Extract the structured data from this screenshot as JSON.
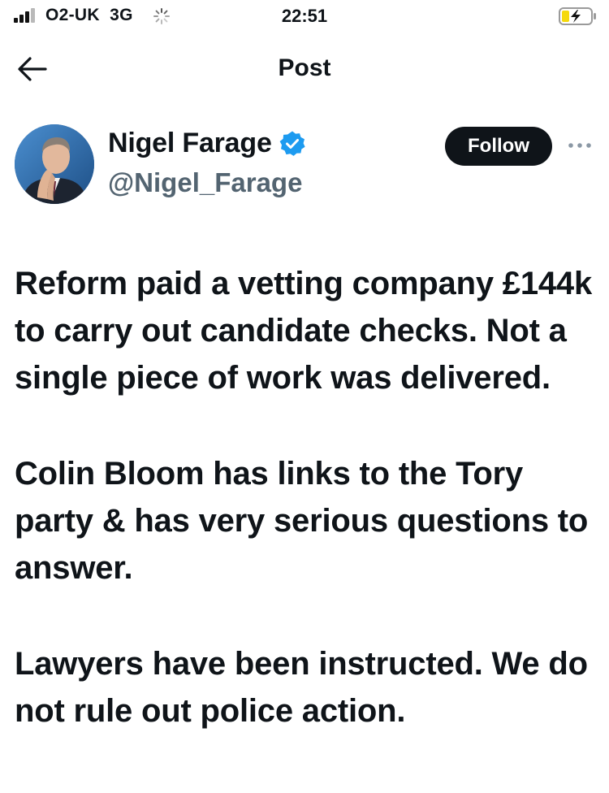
{
  "status_bar": {
    "carrier": "O2-UK",
    "network": "3G",
    "time": "22:51",
    "signal_bars": 3,
    "icons": [
      "signal-icon",
      "loading-spinner-icon",
      "battery-charging-icon"
    ]
  },
  "nav": {
    "back_icon": "arrow-left-icon",
    "title": "Post"
  },
  "author": {
    "display_name": "Nigel Farage",
    "handle": "@Nigel_Farage",
    "verified": true,
    "follow_label": "Follow",
    "more_icon": "more-horizontal-icon"
  },
  "post": {
    "paragraphs": [
      "Reform paid a vetting company £144k to carry out candidate checks. Not a single piece of work was delivered.",
      "Colin Bloom has links to the Tory party & has very serious questions to answer.",
      "Lawyers have been instructed. We do not rule out police action."
    ]
  },
  "colors": {
    "text": "#0f1419",
    "secondary": "#536471",
    "verified_blue": "#1d9bf0",
    "button_bg": "#0f1419",
    "battery_fill": "#f5d90a"
  }
}
